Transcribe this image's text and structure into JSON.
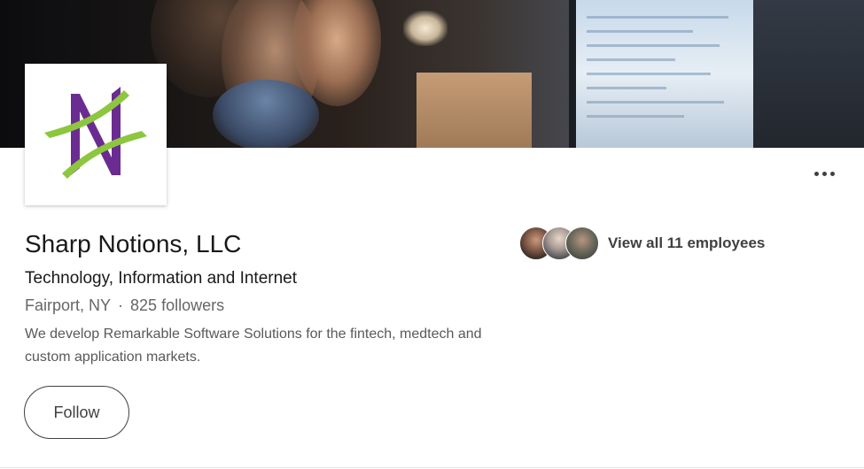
{
  "company": {
    "name": "Sharp Notions, LLC",
    "industry": "Technology, Information and Internet",
    "location": "Fairport, NY",
    "separator": "·",
    "followers": "825 followers",
    "tagline": "We develop Remarkable Software Solutions for the fintech, medtech and custom application markets."
  },
  "actions": {
    "follow_label": "Follow",
    "more_icon": "ellipsis-icon"
  },
  "employees": {
    "label": "View all 11 employees",
    "avatar_count": 3
  },
  "colors": {
    "logo_purple": "#6a2c91",
    "logo_green": "#8dc63f",
    "text_primary": "#191919",
    "text_secondary": "#666666"
  }
}
